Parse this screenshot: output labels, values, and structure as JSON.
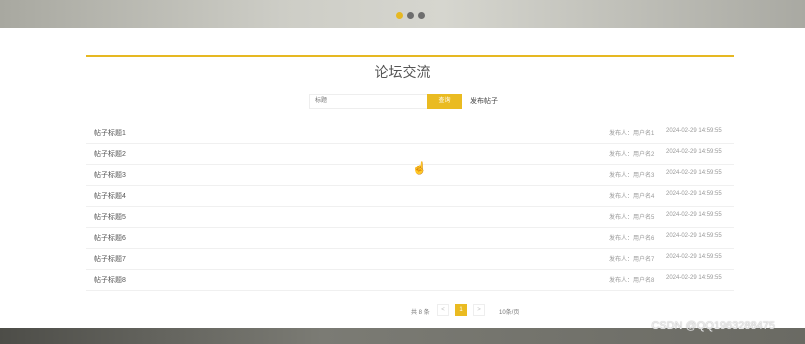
{
  "title": "论坛交流",
  "search": {
    "placeholder": "标题",
    "query_label": "查询",
    "post_label": "发布帖子"
  },
  "posts": [
    {
      "title": "帖子标题1",
      "author": "发布人：用户名1",
      "date": "2024-02-29 14:59:55"
    },
    {
      "title": "帖子标题2",
      "author": "发布人：用户名2",
      "date": "2024-02-29 14:59:55"
    },
    {
      "title": "帖子标题3",
      "author": "发布人：用户名3",
      "date": "2024-02-29 14:59:55"
    },
    {
      "title": "帖子标题4",
      "author": "发布人：用户名4",
      "date": "2024-02-29 14:59:55"
    },
    {
      "title": "帖子标题5",
      "author": "发布人：用户名5",
      "date": "2024-02-29 14:59:55"
    },
    {
      "title": "帖子标题6",
      "author": "发布人：用户名6",
      "date": "2024-02-29 14:59:55"
    },
    {
      "title": "帖子标题7",
      "author": "发布人：用户名7",
      "date": "2024-02-29 14:59:55"
    },
    {
      "title": "帖子标题8",
      "author": "发布人：用户名8",
      "date": "2024-02-29 14:59:55"
    }
  ],
  "pagination": {
    "total": "共 8 条",
    "prev": "<",
    "page": "1",
    "next": ">",
    "page_size": "10条/页"
  },
  "watermark": "CSDN @QQ1963288475",
  "colors": {
    "accent": "#eabb21"
  }
}
